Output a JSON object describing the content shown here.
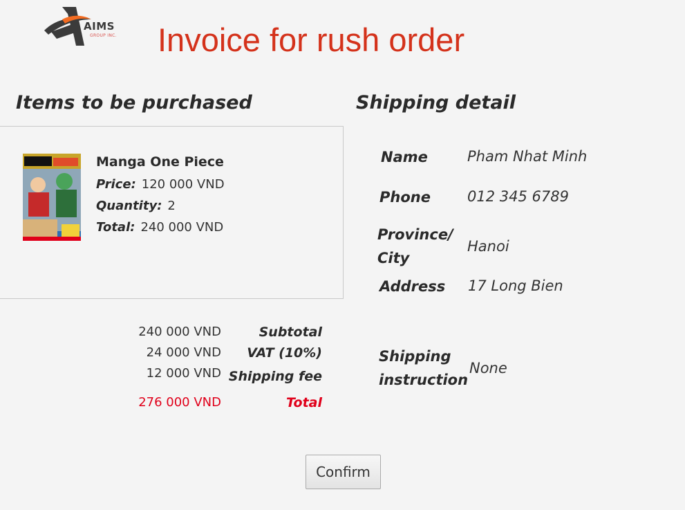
{
  "logo": {
    "text": "AIMS",
    "sub": "GROUP INC."
  },
  "page_title": "Invoice for rush order",
  "items_section": {
    "title": "Items to be purchased",
    "item": {
      "cover_icon": "manga-cover-image",
      "name": "Manga One Piece",
      "price_label": "Price:",
      "price": "120 000 VND",
      "quantity_label": "Quantity:",
      "quantity": "2",
      "total_label": "Total:",
      "total": "240 000 VND"
    }
  },
  "summary": {
    "subtotal_value": "240 000 VND",
    "subtotal_label": "Subtotal",
    "vat_value": "24 000 VND",
    "vat_label": "VAT (10%)",
    "shipping_value": "12 000 VND",
    "shipping_label": "Shipping fee",
    "total_value": "276 000 VND",
    "total_label": "Total"
  },
  "shipping": {
    "title": "Shipping detail",
    "name_label": "Name",
    "name": "Pham Nhat Minh",
    "phone_label": "Phone",
    "phone": "012 345 6789",
    "province_label_line1": "Province/",
    "province_label_line2": "City",
    "province": "Hanoi",
    "address_label": "Address",
    "address": "17 Long Bien",
    "instruction_label_line1": "Shipping",
    "instruction_label_line2": "instruction",
    "instruction": "None"
  },
  "confirm_label": "Confirm",
  "colors": {
    "title": "#d4321b",
    "total": "#e0001a",
    "background": "#f4f4f4"
  }
}
